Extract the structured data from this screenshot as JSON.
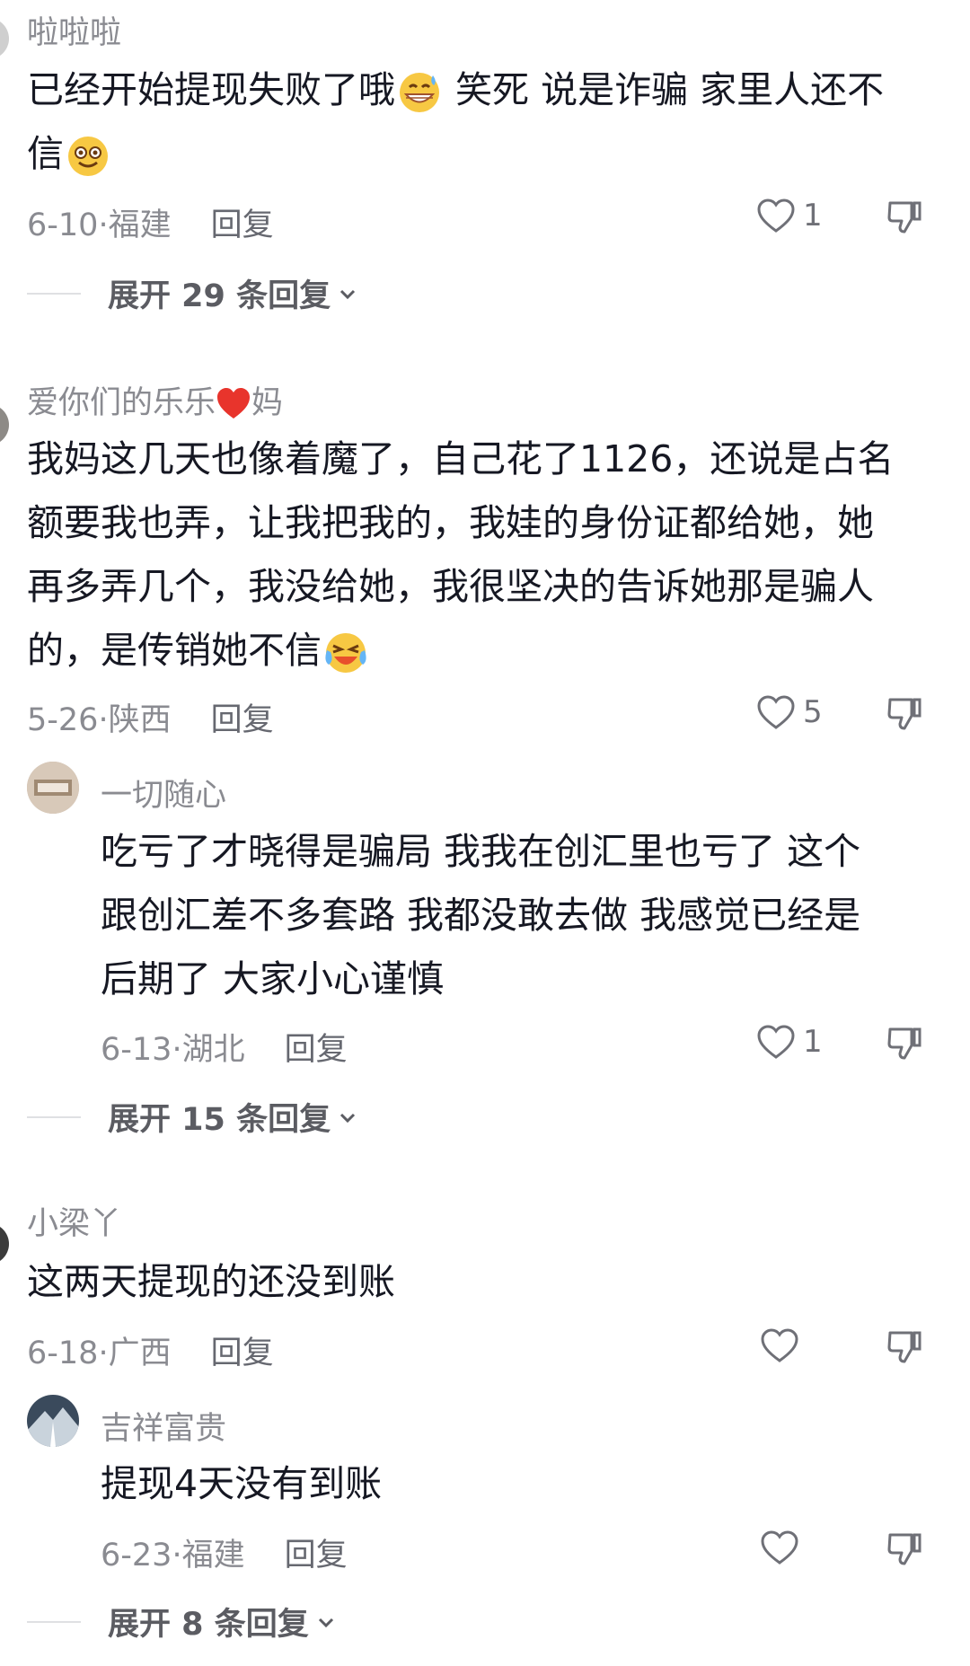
{
  "comments": [
    {
      "username": "啦啦啦",
      "lines": [
        "已经开始提现失败了哦",
        "笑死 说是诈骗 家里人还不",
        "信"
      ],
      "date": "6-10",
      "location": "福建",
      "reply_label": "回复",
      "likes": "1",
      "expand_label": "展开 29 条回复"
    },
    {
      "username_prefix": "爱你们的乐乐",
      "username_suffix": "妈",
      "lines": [
        "我妈这几天也像着魔了，自己花了1126，还说是占名",
        "额要我也弄，让我把我的，我娃的身份证都给她，她",
        "再多弄几个，我没给她，我很坚决的告诉她那是骗人",
        "的，是传销她不信"
      ],
      "date": "5-26",
      "location": "陕西",
      "reply_label": "回复",
      "likes": "5",
      "reply": {
        "username": "一切随心",
        "lines": [
          "吃亏了才晓得是骗局 我我在创汇里也亏了 这个",
          "跟创汇差不多套路 我都没敢去做 我感觉已经是",
          "后期了 大家小心谨慎"
        ],
        "date": "6-13",
        "location": "湖北",
        "reply_label": "回复",
        "likes": "1"
      },
      "expand_label": "展开 15 条回复"
    },
    {
      "username": "小梁丫",
      "lines": [
        "这两天提现的还没到账"
      ],
      "date": "6-18",
      "location": "广西",
      "reply_label": "回复",
      "reply": {
        "username": "吉祥富贵",
        "lines": [
          "提现4天没有到账"
        ],
        "date": "6-23",
        "location": "福建",
        "reply_label": "回复"
      },
      "expand_label": "展开 8 条回复"
    }
  ],
  "icons": {
    "like": "heart-outline-icon",
    "dislike": "thumbs-down-icon",
    "expand": "chevron-down-icon"
  }
}
